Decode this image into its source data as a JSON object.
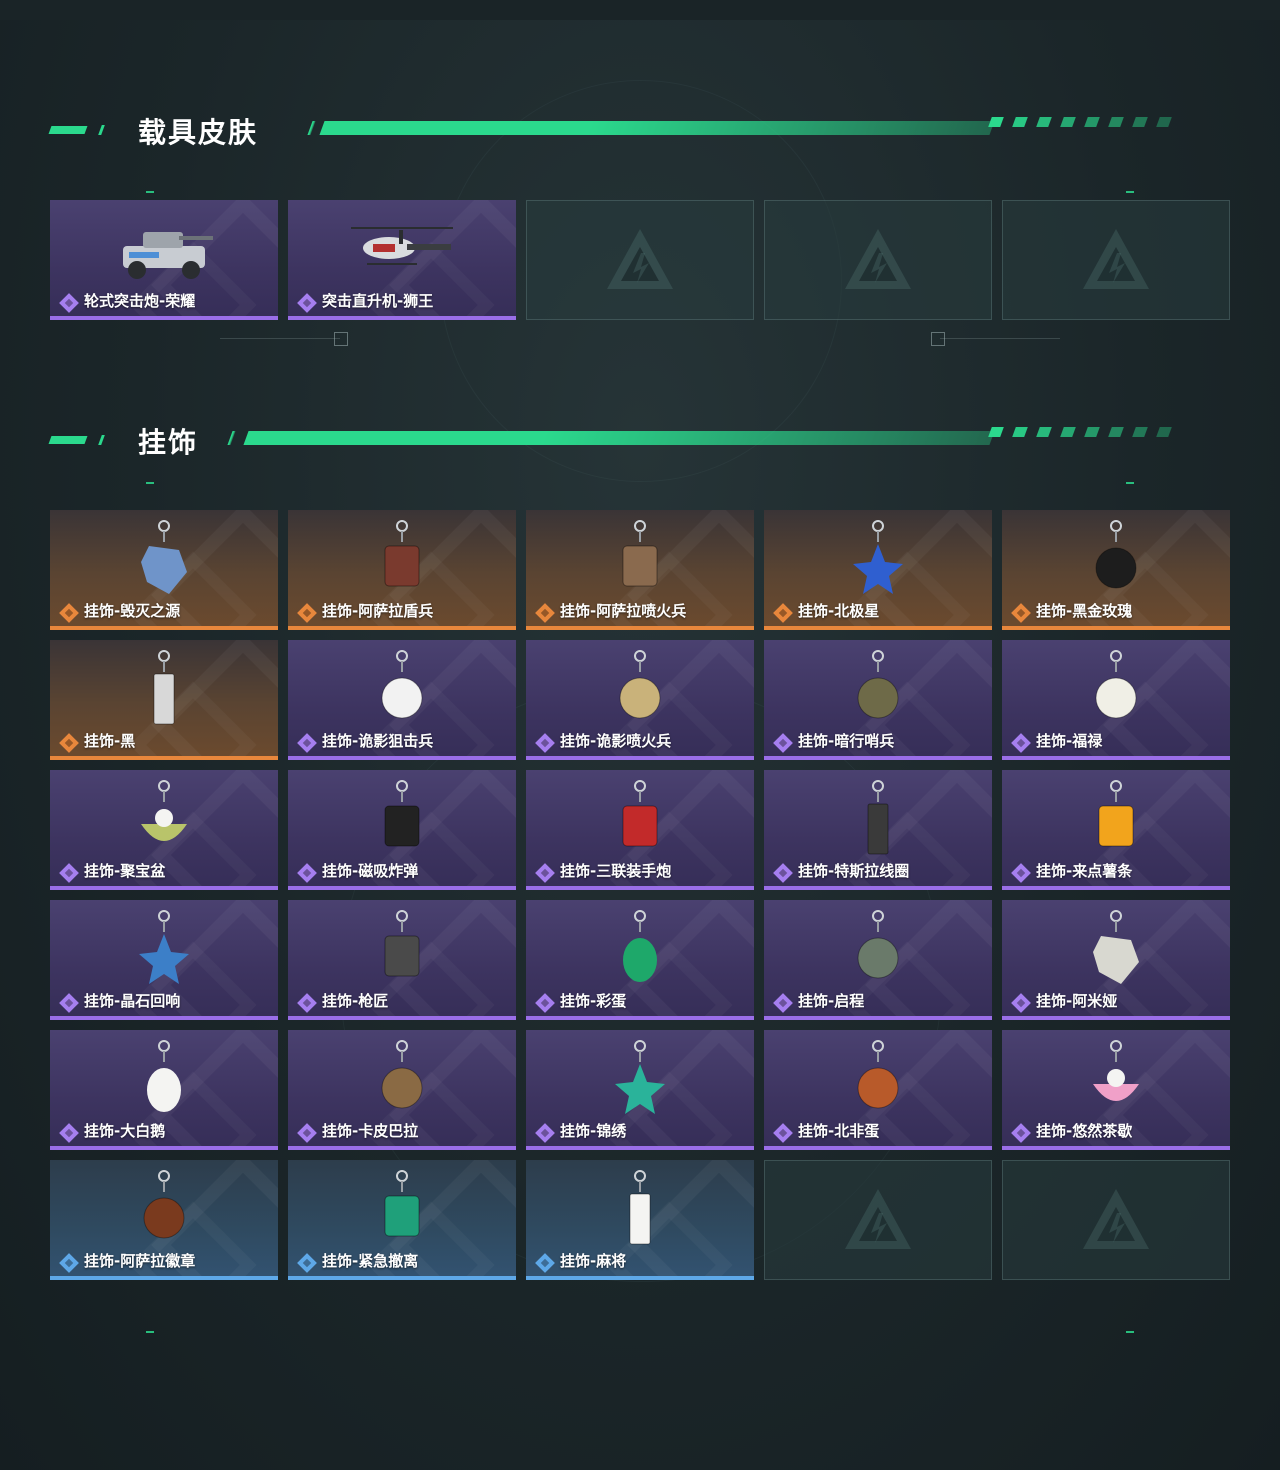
{
  "sections": [
    {
      "title": "载具皮肤",
      "items": [
        {
          "label": "轮式突击炮-荣耀",
          "rarity": "purple",
          "icon": "armored-vehicle-icon"
        },
        {
          "label": "突击直升机-狮王",
          "rarity": "purple",
          "icon": "helicopter-icon"
        },
        {
          "label": "",
          "rarity": "empty",
          "icon": "placeholder-logo-icon"
        },
        {
          "label": "",
          "rarity": "empty",
          "icon": "placeholder-logo-icon"
        },
        {
          "label": "",
          "rarity": "empty",
          "icon": "placeholder-logo-icon"
        }
      ]
    },
    {
      "title": "挂饰",
      "items": [
        {
          "label": "挂饰-毁灭之源",
          "rarity": "orange",
          "icon": "dragon-charm-icon"
        },
        {
          "label": "挂饰-阿萨拉盾兵",
          "rarity": "orange",
          "icon": "shield-soldier-charm-icon"
        },
        {
          "label": "挂饰-阿萨拉喷火兵",
          "rarity": "orange",
          "icon": "flamethrower-soldier-charm-icon"
        },
        {
          "label": "挂饰-北极星",
          "rarity": "orange",
          "icon": "star-charm-icon"
        },
        {
          "label": "挂饰-黑金玫瑰",
          "rarity": "orange",
          "icon": "rose-charm-icon"
        },
        {
          "label": "挂饰-黑",
          "rarity": "orange",
          "icon": "tag-charm-icon"
        },
        {
          "label": "挂饰-诡影狙击兵",
          "rarity": "purple",
          "icon": "sniper-charm-icon"
        },
        {
          "label": "挂饰-诡影喷火兵",
          "rarity": "purple",
          "icon": "flame-soldier-charm-icon"
        },
        {
          "label": "挂饰-暗行哨兵",
          "rarity": "purple",
          "icon": "sentinel-charm-icon"
        },
        {
          "label": "挂饰-福禄",
          "rarity": "purple",
          "icon": "gourd-charm-icon"
        },
        {
          "label": "挂饰-聚宝盆",
          "rarity": "purple",
          "icon": "treasure-bowl-charm-icon"
        },
        {
          "label": "挂饰-磁吸炸弹",
          "rarity": "purple",
          "icon": "bomb-charm-icon"
        },
        {
          "label": "挂饰-三联装手炮",
          "rarity": "purple",
          "icon": "hand-cannon-charm-icon"
        },
        {
          "label": "挂饰-特斯拉线圈",
          "rarity": "purple",
          "icon": "tesla-coil-charm-icon"
        },
        {
          "label": "挂饰-来点薯条",
          "rarity": "purple",
          "icon": "fries-charm-icon"
        },
        {
          "label": "挂饰-晶石回响",
          "rarity": "purple",
          "icon": "crystal-charm-icon"
        },
        {
          "label": "挂饰-枪匠",
          "rarity": "purple",
          "icon": "toolbox-charm-icon"
        },
        {
          "label": "挂饰-彩蛋",
          "rarity": "purple",
          "icon": "egg-charm-icon"
        },
        {
          "label": "挂饰-启程",
          "rarity": "purple",
          "icon": "medallion-charm-icon"
        },
        {
          "label": "挂饰-阿米娅",
          "rarity": "purple",
          "icon": "rabbit-charm-icon"
        },
        {
          "label": "挂饰-大白鹅",
          "rarity": "purple",
          "icon": "goose-charm-icon"
        },
        {
          "label": "挂饰-卡皮巴拉",
          "rarity": "purple",
          "icon": "capybara-charm-icon"
        },
        {
          "label": "挂饰-锦绣",
          "rarity": "purple",
          "icon": "butterfly-charm-icon"
        },
        {
          "label": "挂饰-北非蛋",
          "rarity": "purple",
          "icon": "shakshuka-charm-icon"
        },
        {
          "label": "挂饰-悠然茶歇",
          "rarity": "purple",
          "icon": "cupcake-charm-icon"
        },
        {
          "label": "挂饰-阿萨拉徽章",
          "rarity": "blue",
          "icon": "badge-charm-icon"
        },
        {
          "label": "挂饰-紧急撤离",
          "rarity": "blue",
          "icon": "skull-charm-icon"
        },
        {
          "label": "挂饰-麻将",
          "rarity": "blue",
          "icon": "mahjong-charm-icon"
        },
        {
          "label": "",
          "rarity": "empty",
          "icon": "placeholder-logo-icon"
        },
        {
          "label": "",
          "rarity": "empty",
          "icon": "placeholder-logo-icon"
        }
      ]
    }
  ],
  "colors": {
    "accent_green": "#2bd98d",
    "rarity_orange": "#e8873c",
    "rarity_purple": "#9a6ee8",
    "rarity_blue": "#5ea8e8"
  }
}
